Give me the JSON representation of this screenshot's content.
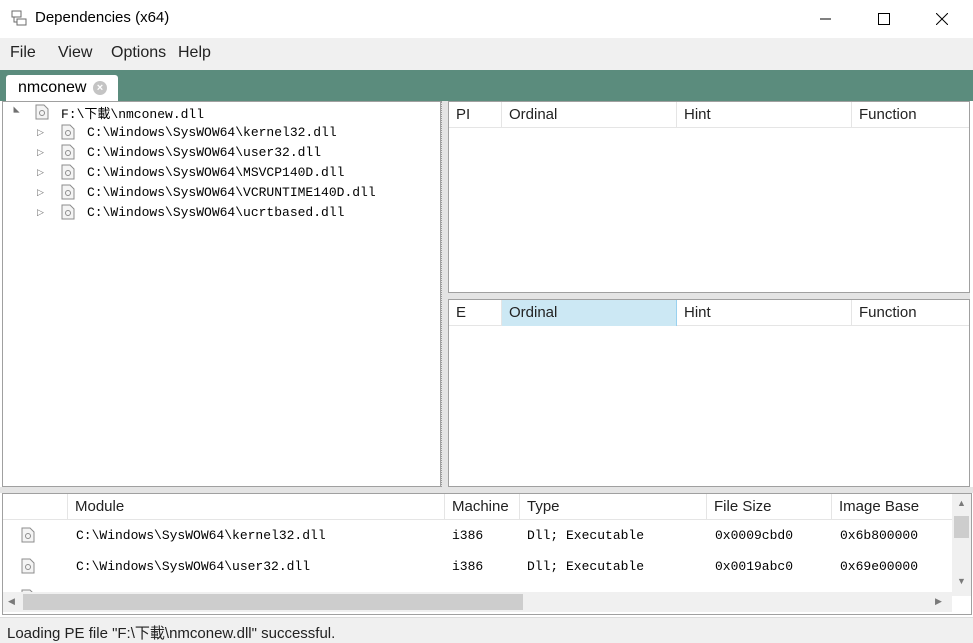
{
  "window": {
    "title": "Dependencies (x64)",
    "controls": {
      "minimize": "—",
      "maximize": "☐",
      "close": "✕"
    }
  },
  "menu": {
    "items": [
      {
        "label": "File"
      },
      {
        "label": "View"
      },
      {
        "label": "Options"
      },
      {
        "label": "Help"
      }
    ]
  },
  "tabs": [
    {
      "label": "nmconew",
      "close_glyph": "×"
    }
  ],
  "tree": {
    "root": {
      "label": "F:\\下載\\nmconew.dll",
      "expanded": true
    },
    "children": [
      {
        "label": "C:\\Windows\\SysWOW64\\kernel32.dll"
      },
      {
        "label": "C:\\Windows\\SysWOW64\\user32.dll"
      },
      {
        "label": "C:\\Windows\\SysWOW64\\MSVCP140D.dll"
      },
      {
        "label": "C:\\Windows\\SysWOW64\\VCRUNTIME140D.dll"
      },
      {
        "label": "C:\\Windows\\SysWOW64\\ucrtbased.dll"
      }
    ],
    "icons": {
      "expanded": "▲",
      "collapsed": "▷"
    }
  },
  "imports_grid": {
    "columns": [
      "PI",
      "Ordinal",
      "Hint",
      "Function"
    ]
  },
  "exports_grid": {
    "columns": [
      "E",
      "Ordinal",
      "Hint",
      "Function"
    ],
    "selected_column": "Ordinal"
  },
  "modules_grid": {
    "columns": [
      "Module",
      "Machine",
      "Type",
      "File Size",
      "Image Base"
    ],
    "rows": [
      {
        "module": "C:\\Windows\\SysWOW64\\kernel32.dll",
        "machine": "i386",
        "type": "Dll; Executable",
        "file_size": "0x0009cbd0",
        "image_base": "0x6b800000"
      },
      {
        "module": "C:\\Windows\\SysWOW64\\user32.dll",
        "machine": "i386",
        "type": "Dll; Executable",
        "file_size": "0x0019abc0",
        "image_base": "0x69e00000"
      }
    ]
  },
  "status": {
    "text": "Loading PE file \"F:\\下載\\nmconew.dll\" successful."
  },
  "colors": {
    "tab_strip": "#5b8c7d",
    "selected_header": "#cce8f4"
  }
}
